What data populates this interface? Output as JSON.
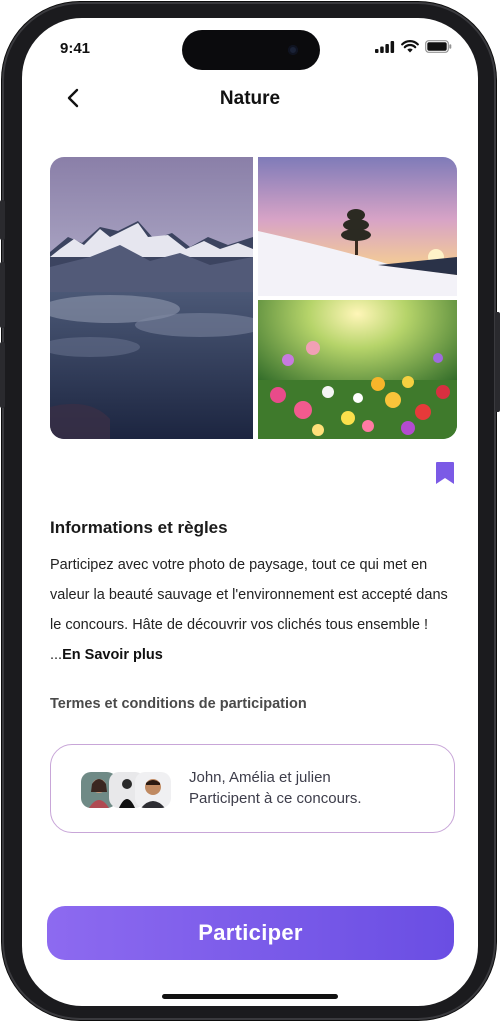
{
  "status_bar": {
    "time": "9:41"
  },
  "header": {
    "title": "Nature"
  },
  "gallery": {
    "photos": [
      {
        "icon": "mountain-photo"
      },
      {
        "icon": "snowy-tree-photo"
      },
      {
        "icon": "flowers-photo"
      }
    ]
  },
  "info": {
    "title": "Informations et règles",
    "description": "Participez avec votre photo de paysage, tout ce qui met en valeur la beauté sauvage et l'environnement est accepté dans le concours. Hâte de découvrir vos clichés tous ensemble ! ...",
    "more_link": "En Savoir plus"
  },
  "terms": {
    "label": "Termes et conditions de participation"
  },
  "participants": {
    "line1": "John, Amélia et julien",
    "line2": "Participent à ce concours."
  },
  "cta": {
    "label": "Participer"
  },
  "colors": {
    "accent": "#7a5cea",
    "card_border": "#c8a6d8",
    "bookmark": "#7b5ae6"
  }
}
